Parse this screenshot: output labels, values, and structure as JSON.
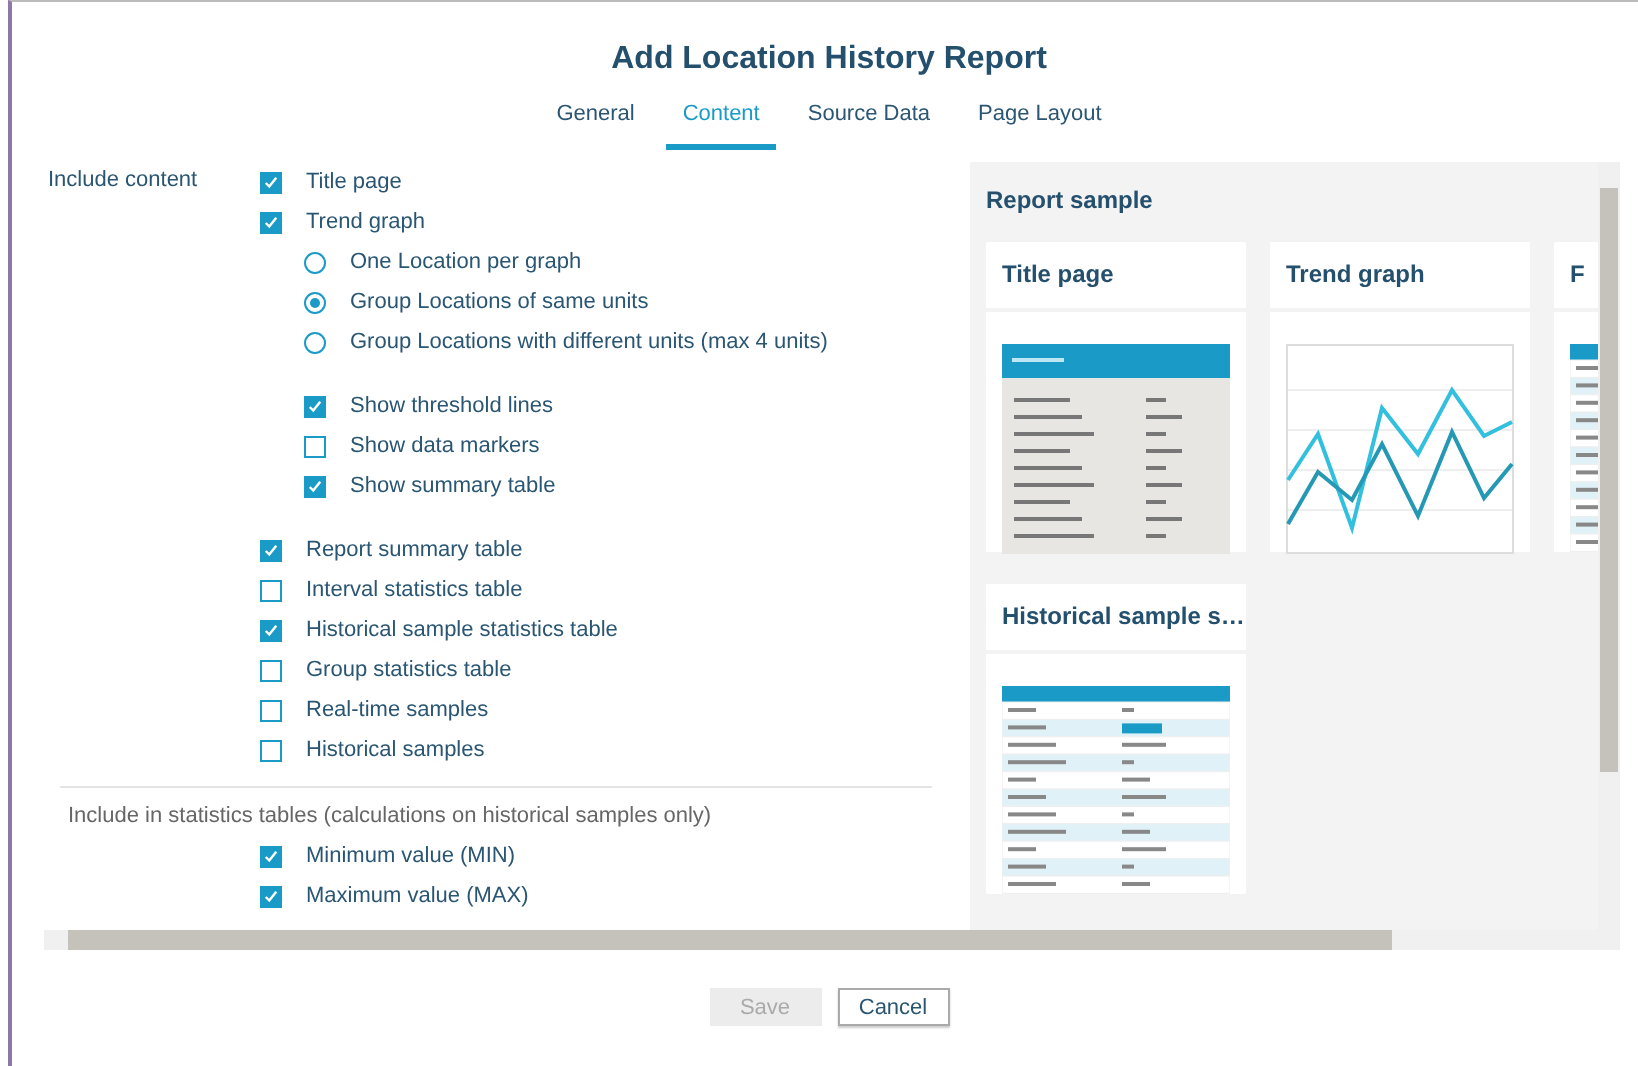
{
  "dialog": {
    "title": "Add Location History Report",
    "tabs": [
      {
        "label": "General",
        "selected": false
      },
      {
        "label": "Content",
        "selected": true
      },
      {
        "label": "Source Data",
        "selected": false
      },
      {
        "label": "Page Layout",
        "selected": false
      }
    ],
    "content_options": {
      "label": "Include content",
      "items": [
        {
          "kind": "checkbox",
          "label": "Title page",
          "checked": true
        },
        {
          "kind": "checkbox",
          "label": "Trend graph",
          "checked": true,
          "children": [
            {
              "kind": "radio",
              "label": "One Location per graph",
              "selected": false
            },
            {
              "kind": "radio",
              "label": "Group Locations of same units",
              "selected": true
            },
            {
              "kind": "radio",
              "label": "Group Locations with different units (max 4 units)",
              "selected": false
            },
            {
              "kind": "spacer"
            },
            {
              "kind": "checkbox",
              "label": "Show threshold lines",
              "checked": true
            },
            {
              "kind": "checkbox",
              "label": "Show data markers",
              "checked": false
            },
            {
              "kind": "checkbox",
              "label": "Show summary table",
              "checked": true
            },
            {
              "kind": "spacer"
            }
          ]
        },
        {
          "kind": "checkbox",
          "label": "Report summary table",
          "checked": true
        },
        {
          "kind": "checkbox",
          "label": "Interval statistics table",
          "checked": false
        },
        {
          "kind": "checkbox",
          "label": "Historical sample statistics table",
          "checked": true
        },
        {
          "kind": "checkbox",
          "label": "Group statistics table",
          "checked": false
        },
        {
          "kind": "checkbox",
          "label": "Real-time samples",
          "checked": false
        },
        {
          "kind": "checkbox",
          "label": "Historical samples",
          "checked": false
        }
      ]
    },
    "statistics": {
      "label": "Include in statistics tables (calculations on historical samples only)",
      "items": [
        {
          "kind": "checkbox",
          "label": "Minimum value (MIN)",
          "checked": true
        },
        {
          "kind": "checkbox",
          "label": "Maximum value (MAX)",
          "checked": true
        }
      ]
    },
    "report_sample": {
      "title": "Report sample",
      "cards": [
        {
          "title": "Title page",
          "kind": "document"
        },
        {
          "title": "Trend graph",
          "kind": "graph"
        },
        {
          "title": "F",
          "kind": "table"
        },
        {
          "title": "Historical sample s…",
          "kind": "table"
        }
      ]
    },
    "buttons": [
      {
        "label": "Save",
        "disabled": true
      },
      {
        "label": "Cancel",
        "disabled": false
      }
    ]
  }
}
